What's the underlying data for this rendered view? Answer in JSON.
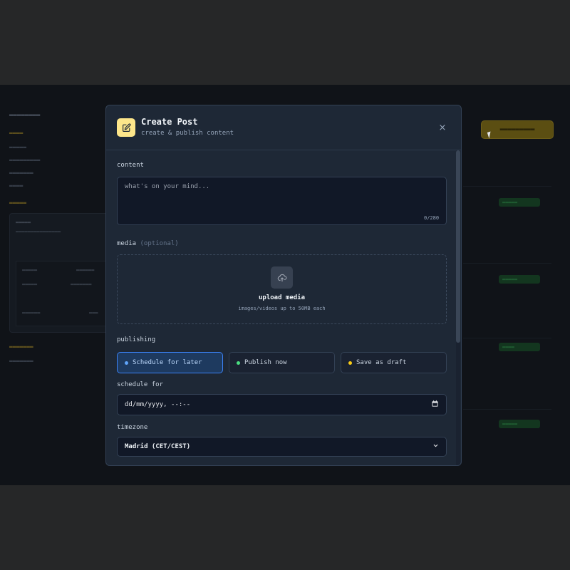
{
  "modal": {
    "title": "Create Post",
    "subtitle": "create & publish content",
    "close_glyph": "×",
    "content_label": "content",
    "content_placeholder": "what's on your mind...",
    "char_counter": "0/280",
    "media_label": "media",
    "media_optional": "(optional)",
    "upload_title": "upload media",
    "upload_hint": "images/videos up to 50MB each",
    "publishing_label": "publishing",
    "publishing_options": [
      {
        "label": "Schedule for later",
        "dot_color": "#60a5fa",
        "selected": true
      },
      {
        "label": "Publish now",
        "dot_color": "#4ade80",
        "selected": false
      },
      {
        "label": "Save as draft",
        "dot_color": "#facc15",
        "selected": false
      }
    ],
    "schedule_label": "schedule for",
    "schedule_value": "dd/mm/yyyy, --:--",
    "timezone_label": "timezone",
    "timezone_value": "Madrid (CET/CEST)"
  },
  "colors": {
    "accent": "#fde68a",
    "selected_bg": "#1e3a5f",
    "selected_border": "#3b82f6",
    "modal_bg": "#1e2836"
  },
  "icons": {
    "header": "edit-icon",
    "close": "close-icon",
    "upload": "upload-cloud-icon",
    "calendar": "calendar-icon",
    "select": "chevron-down-icon"
  }
}
